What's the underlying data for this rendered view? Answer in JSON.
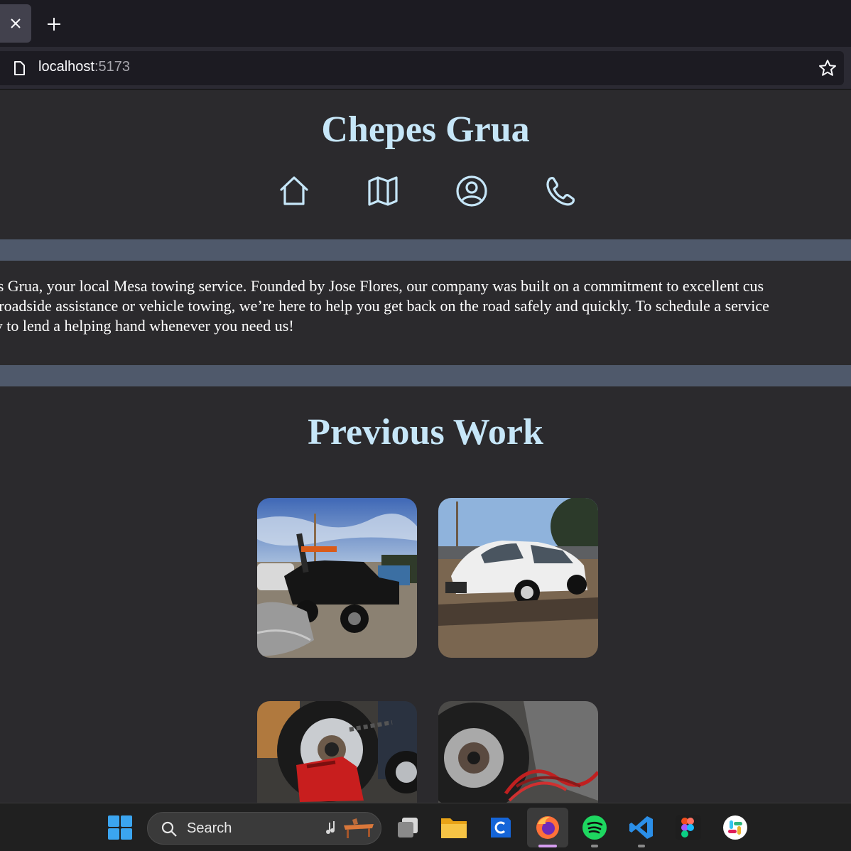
{
  "browser": {
    "url_host": "localhost",
    "url_port": ":5173"
  },
  "site": {
    "title": "Chepes Grua",
    "nav_icons": [
      "home-icon",
      "map-icon",
      "user-circle-icon",
      "phone-icon"
    ],
    "about_lines": [
      "pe's Grua, your local Mesa towing service. Founded by Jose Flores, our company was built on a commitment to excellent cus",
      "ed roadside assistance or vehicle towing, we’re here to help you get back on the road safely and quickly. To schedule a service",
      "ady to lend a helping hand whenever you need us!"
    ],
    "section_title": "Previous Work",
    "gallery": [
      "tow-truck-photo",
      "white-prius-photo",
      "truck-wheel-gas-can-photo",
      "truck-wheel-cables-photo"
    ]
  },
  "colors": {
    "accent": "#c6e6f8",
    "band": "#4f596b",
    "page_bg": "#2b2a2d"
  },
  "taskbar": {
    "search_label": "Search",
    "apps": [
      "windows-start-icon",
      "search-icon",
      "task-view-icon",
      "file-explorer-icon",
      "c-app-icon",
      "firefox-icon",
      "spotify-icon",
      "vscode-icon",
      "figma-icon",
      "slack-icon"
    ]
  }
}
